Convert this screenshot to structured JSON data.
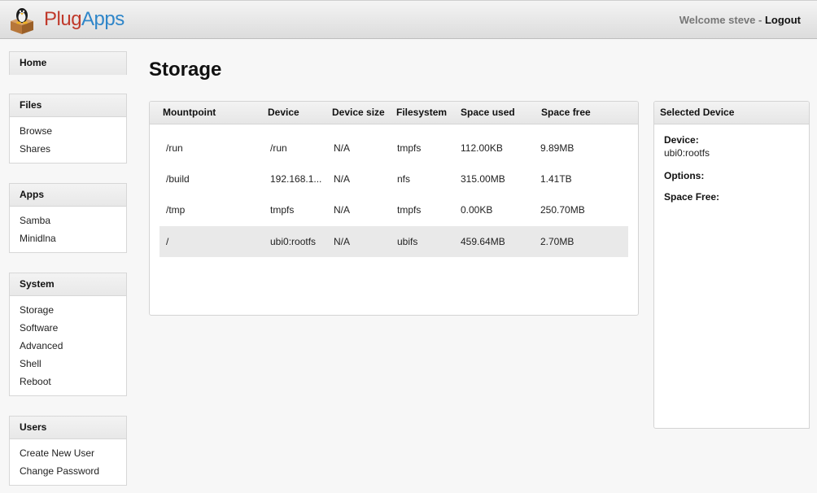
{
  "header": {
    "brand_part1": "Plug",
    "brand_part2": "Apps",
    "welcome_text": "Welcome steve - ",
    "logout_label": "Logout"
  },
  "sidebar": {
    "home": {
      "label": "Home"
    },
    "files": {
      "title": "Files",
      "items": [
        "Browse",
        "Shares"
      ]
    },
    "apps": {
      "title": "Apps",
      "items": [
        "Samba",
        "Minidlna"
      ]
    },
    "system": {
      "title": "System",
      "items": [
        "Storage",
        "Software",
        "Advanced",
        "Shell",
        "Reboot"
      ]
    },
    "users": {
      "title": "Users",
      "items": [
        "Create New User",
        "Change Password"
      ]
    }
  },
  "page": {
    "title": "Storage"
  },
  "table": {
    "columns": [
      "Mountpoint",
      "Device",
      "Device size",
      "Filesystem",
      "Space used",
      "Space free"
    ],
    "rows": [
      {
        "mountpoint": "/run",
        "device": "/run",
        "size": "N/A",
        "fs": "tmpfs",
        "used": "112.00KB",
        "free": "9.89MB"
      },
      {
        "mountpoint": "/build",
        "device": "192.168.1...",
        "size": "N/A",
        "fs": "nfs",
        "used": "315.00MB",
        "free": "1.41TB"
      },
      {
        "mountpoint": "/tmp",
        "device": "tmpfs",
        "size": "N/A",
        "fs": "tmpfs",
        "used": "0.00KB",
        "free": "250.70MB"
      },
      {
        "mountpoint": "/",
        "device": "ubi0:rootfs",
        "size": "N/A",
        "fs": "ubifs",
        "used": "459.64MB",
        "free": "2.70MB"
      }
    ],
    "selected_row": 3
  },
  "detail": {
    "title": "Selected Device",
    "device_label": "Device:",
    "device_value": "ubi0:rootfs",
    "options_label": "Options:",
    "space_free_label": "Space Free:"
  },
  "colors": {
    "brand_red": "#c0392b",
    "brand_blue": "#2f86c9",
    "selected_row": "#e9e9e9"
  },
  "icons": {
    "logo": "tux-on-box-logo"
  }
}
